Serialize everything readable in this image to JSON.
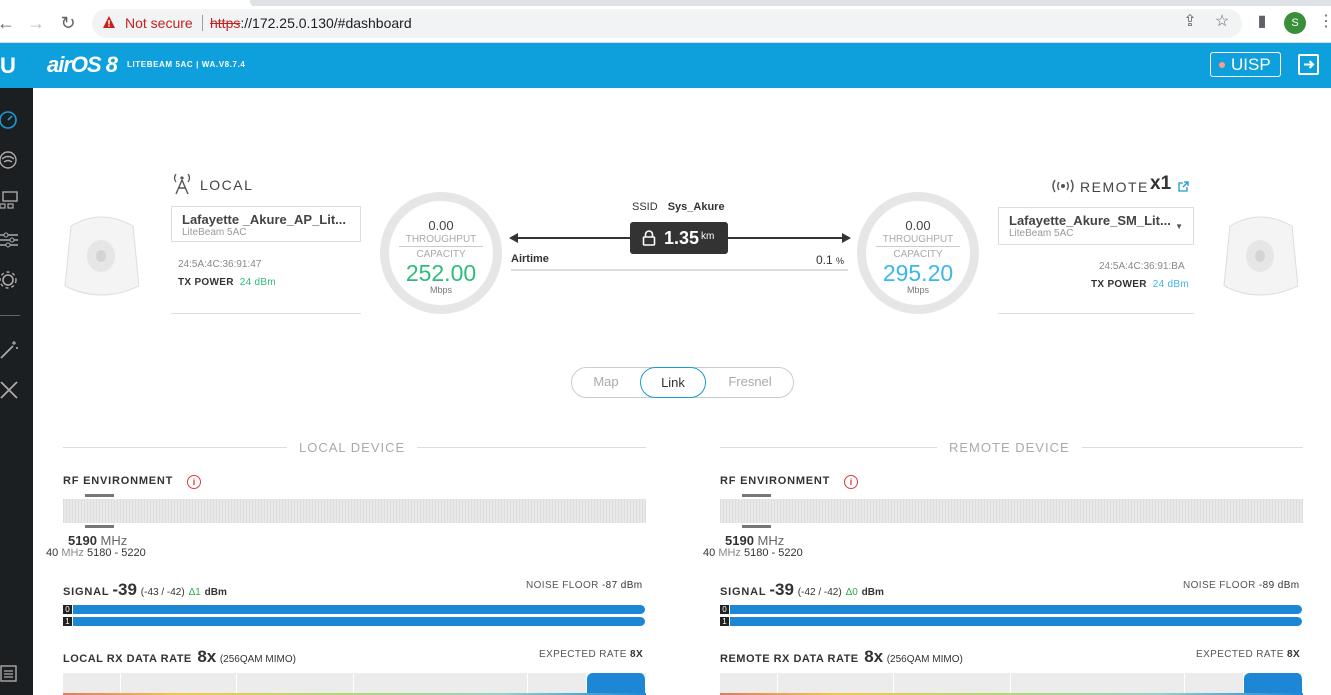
{
  "browser": {
    "not_secure": "Not secure",
    "url_scheme": "https",
    "url_rest": "://172.25.0.130/#dashboard",
    "profile_initial": "S"
  },
  "header": {
    "logo": "U",
    "brand": "airOS 8",
    "device_info": "LITEBEAM 5AC | WA.V8.7.4",
    "uisp_label": "UISP",
    "accent_color": "#0ea0dc"
  },
  "sidebar": {
    "items": [
      "dashboard",
      "wireless",
      "network",
      "services",
      "system",
      "tools-wizard",
      "tools"
    ]
  },
  "local": {
    "heading": "LOCAL",
    "device_name": "Lafayette _Akure_AP_Lit...",
    "model": "LiteBeam 5AC",
    "mac": "24:5A:4C:36:91:47",
    "tx_label": "TX POWER",
    "tx_value": "24 dBm",
    "throughput": "0.00",
    "throughput_label": "THROUGHPUT",
    "capacity_label": "CAPACITY",
    "capacity": "252.00",
    "unit": "Mbps",
    "color": "#2dbd7a"
  },
  "remote": {
    "heading": "REMOTE",
    "count": "x1",
    "device_name": "Lafayette_Akure_SM_Lit...",
    "model": "LiteBeam 5AC",
    "mac": "24:5A:4C:36:91:BA",
    "tx_label": "TX POWER",
    "tx_value": "24 dBm",
    "throughput": "0.00",
    "throughput_label": "THROUGHPUT",
    "capacity_label": "CAPACITY",
    "capacity": "295.20",
    "unit": "Mbps",
    "color": "#3bb7ea"
  },
  "link": {
    "ssid_label": "SSID",
    "ssid": "Sys_Akure",
    "distance": "1.35",
    "distance_unit": "km",
    "airtime_label": "Airtime",
    "airtime_value": "0.1",
    "airtime_unit": "%"
  },
  "tabs": [
    "Map",
    "Link",
    "Fresnel"
  ],
  "active_tab": "Link",
  "local_device": {
    "title": "LOCAL DEVICE",
    "rf_label": "RF ENVIRONMENT",
    "freq": "5190",
    "freq_unit": "MHz",
    "width": "40",
    "width_unit": "MHz",
    "range": "5180 - 5220",
    "signal_label": "SIGNAL",
    "signal": "-39",
    "signal_chains": "(-43 / -42)",
    "signal_delta": "Δ1",
    "signal_unit": "dBm",
    "noise_label": "NOISE FLOOR",
    "noise_value": "-87 dBm",
    "chain0": "0",
    "chain1": "1",
    "rate_label": "LOCAL RX DATA RATE",
    "rate": "8x",
    "rate_mod": "(256QAM MIMO)",
    "expected_label": "EXPECTED RATE",
    "expected_value": "8X"
  },
  "remote_device": {
    "title": "REMOTE DEVICE",
    "rf_label": "RF ENVIRONMENT",
    "freq": "5190",
    "freq_unit": "MHz",
    "width": "40",
    "width_unit": "MHz",
    "range": "5180 - 5220",
    "signal_label": "SIGNAL",
    "signal": "-39",
    "signal_chains": "(-42 / -42)",
    "signal_delta": "Δ0",
    "signal_unit": "dBm",
    "noise_label": "NOISE FLOOR",
    "noise_value": "-89 dBm",
    "chain0": "0",
    "chain1": "1",
    "rate_label": "REMOTE RX DATA RATE",
    "rate": "8x",
    "rate_mod": "(256QAM MIMO)",
    "expected_label": "EXPECTED RATE",
    "expected_value": "8X"
  }
}
